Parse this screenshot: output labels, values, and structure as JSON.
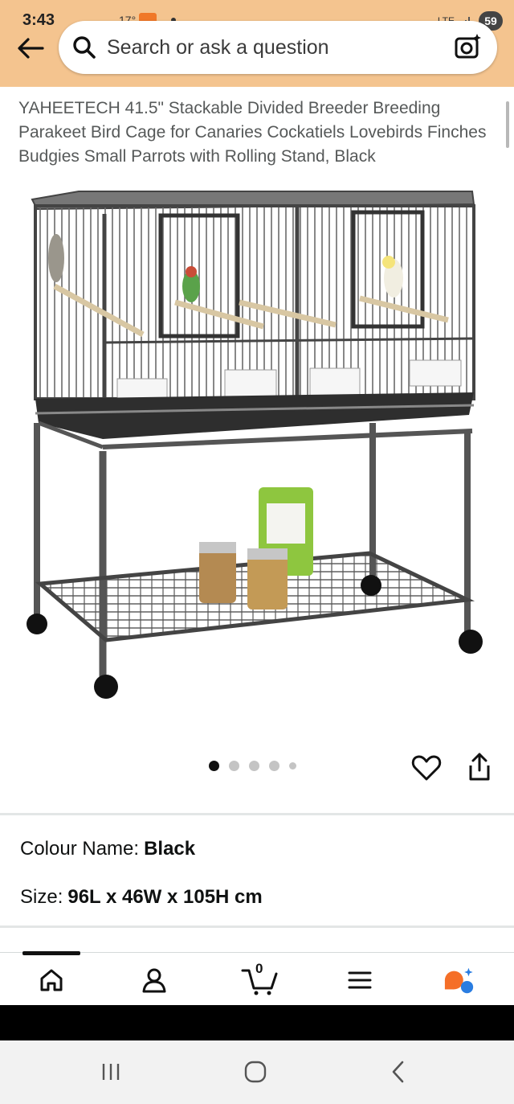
{
  "status_bar": {
    "time": "3:43",
    "extra": "17°",
    "network": "LTE",
    "battery": "59"
  },
  "search": {
    "placeholder": "Search or ask a question"
  },
  "product": {
    "title": "YAHEETECH 41.5\" Stackable Divided Breeder Breeding Parakeet Bird Cage for Canaries Cockatiels Lovebirds Finches Budgies Small Parrots with Rolling Stand, Black",
    "image_icon": "bird-cage-product-image"
  },
  "carousel": {
    "total_dots": 5,
    "active_index": 0
  },
  "attributes": {
    "colour_label": "Colour Name:",
    "colour_value": "Black",
    "size_label": "Size:",
    "size_value": "96L x 46W x 105H cm"
  },
  "bottom_nav": {
    "cart_count": "0",
    "items": [
      "home-icon",
      "account-icon",
      "cart-icon",
      "menu-icon",
      "rufus-icon"
    ]
  },
  "colors": {
    "header_bg": "#f4c48f",
    "rufus_orange": "#f56f28",
    "rufus_blue": "#2a7de1"
  }
}
